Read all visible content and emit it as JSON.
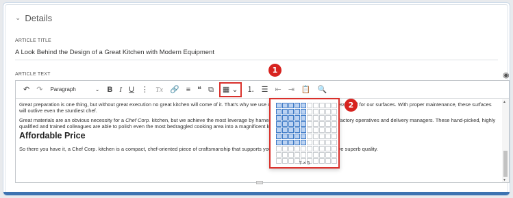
{
  "details": {
    "chevron_icon": "chevron-down-icon",
    "label": "Details"
  },
  "title_field": {
    "label": "ARTICLE TITLE",
    "value": "A Look Behind the Design of a Great Kitchen with Modern Equipment"
  },
  "text_field": {
    "label": "ARTICLE TEXT"
  },
  "toolbar": {
    "undo": "↶",
    "redo": "↷",
    "paragraph_value": "Paragraph",
    "dropdown_caret": "⌄",
    "bold": "B",
    "italic": "I",
    "underline": "U",
    "more": "⋮",
    "clear_format": "Tx",
    "link": "🔗",
    "align": "≡",
    "quote": "❝",
    "insert": "⧉",
    "table": "▦",
    "ordered_list": "⒈",
    "bullet_list": "☰",
    "outdent": "⇤",
    "indent": "⇥",
    "paste": "📋",
    "find": "🔍"
  },
  "content": {
    "p1": "Great preparation is one thing, but without great execution no great kitchen will come of it. That's why we use only the finest grade 304 stainless steel for our surfaces. With proper maintenance, these surfaces will outlive even the sturdiest chef.",
    "p2_before": "Great materials are an obvious necessity for a ",
    "p2_italic": "Chef Corp.",
    "p2_after": " kitchen, but we achieve the most leverage by harnessing the craftsmanship of our factory operatives and delivery managers. These hand-picked, highly qualified and trained colleagues are able to polish even the most bedraggled cooking area into a magnificent kitchen.",
    "heading": "Affordable Price",
    "p3": "So there you have it, a Chef Corp. kitchen is a compact, chef-oriented piece of craftsmanship that supports your every need in order to achieve superb quality."
  },
  "table_picker": {
    "columns": 10,
    "rows": 10,
    "selected_cols": 5,
    "selected_rows": 7,
    "size_label": "7 × 5"
  },
  "callouts": [
    "1",
    "2"
  ],
  "colors": {
    "accent": "#3d73b1",
    "callout": "#d7231f",
    "highlight_border": "#d9302b"
  }
}
